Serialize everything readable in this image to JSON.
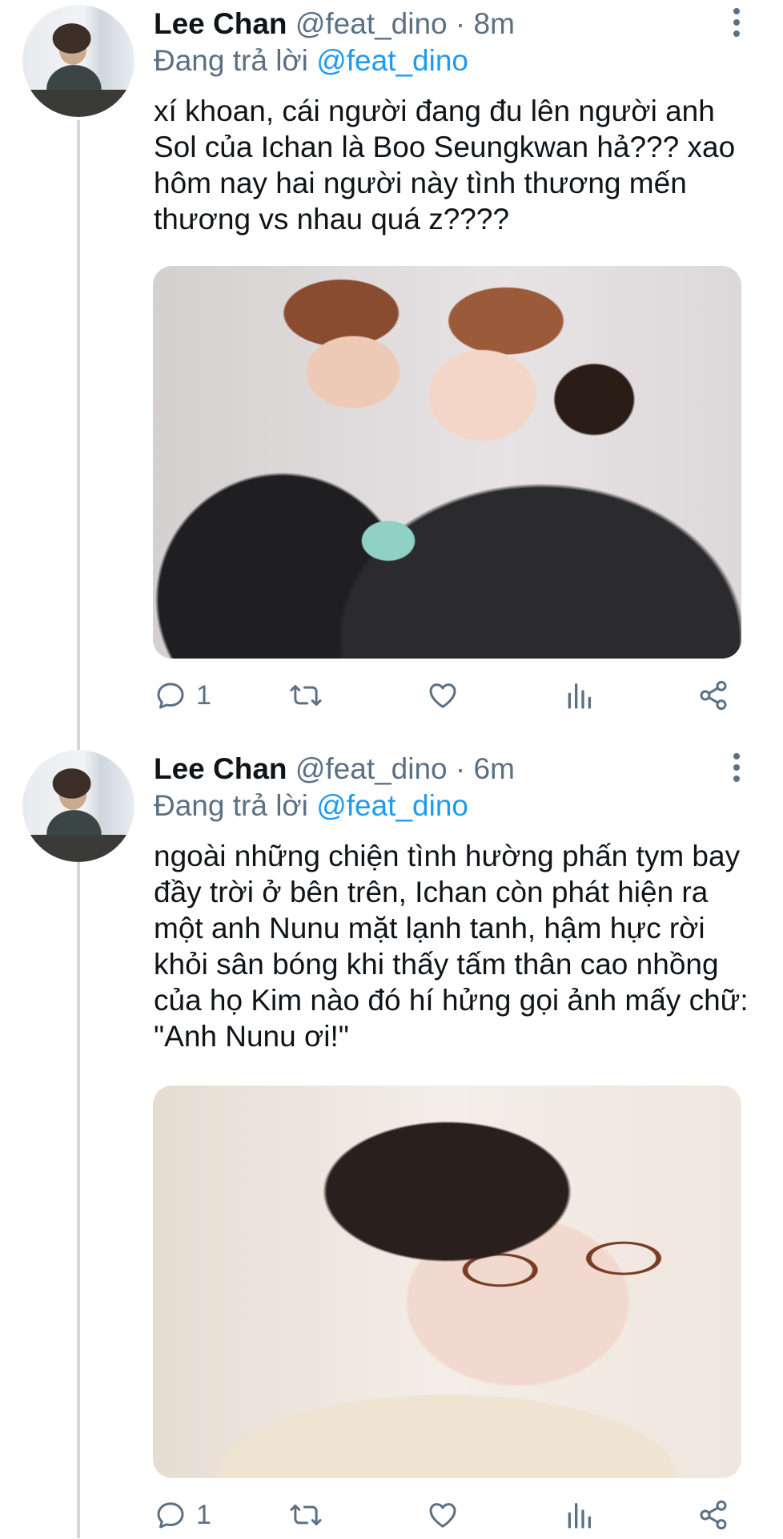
{
  "tweets": [
    {
      "author_name": "Lee Chan",
      "handle": "@feat_dino",
      "separator": "·",
      "time": "8m",
      "replying_prefix": "Đang trả lời",
      "replying_to": "@feat_dino",
      "text": "xí khoan, cái người đang đu lên người anh Sol của Ichan là Boo Seungkwan hả??? xao hôm nay hai người này tình thương mến thương vs nhau quá z????",
      "reply_count": "1"
    },
    {
      "author_name": "Lee Chan",
      "handle": "@feat_dino",
      "separator": "·",
      "time": "6m",
      "replying_prefix": "Đang trả lời",
      "replying_to": "@feat_dino",
      "text": "ngoài những chiện tình hường phấn tym bay đầy trời ở bên trên, Ichan còn phát hiện ra một anh Nunu mặt lạnh tanh, hậm hực rời khỏi sân bóng khi thấy tấm thân cao nhồng của họ Kim nào đó hí hửng gọi ảnh mấy chữ: \"Anh Nunu ơi!\"",
      "reply_count": "1"
    }
  ],
  "colors": {
    "text": "#0f1419",
    "muted": "#5b7083",
    "link": "#1d9bf0",
    "thread_line": "#d0d7dd"
  },
  "icons": [
    "more-vertical-icon",
    "reply-icon",
    "retweet-icon",
    "like-icon",
    "analytics-icon",
    "share-icon"
  ]
}
